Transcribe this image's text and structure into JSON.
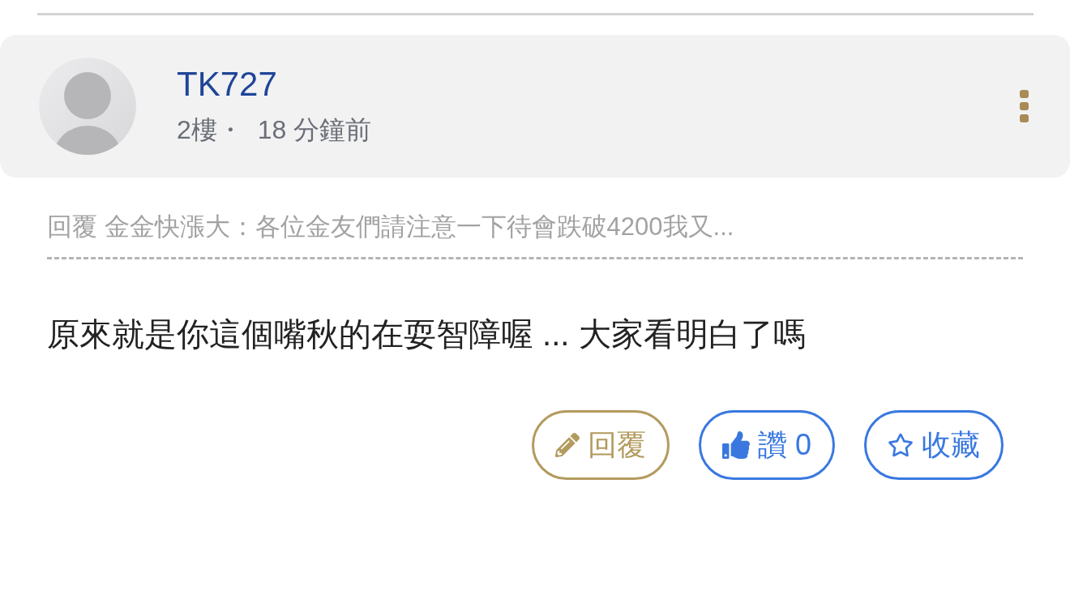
{
  "post": {
    "author": "TK727",
    "floor": "2樓・",
    "time": "18 分鐘前",
    "quote": "回覆 金金快漲大：各位金友們請注意一下待會跌破4200我又...",
    "body": "原來就是你這個嘴秋的在耍智障喔 ... 大家看明白了嗎",
    "actions": [
      {
        "kind": "reply",
        "label": "回覆"
      },
      {
        "kind": "like",
        "label": "讚 0"
      },
      {
        "kind": "favorite",
        "label": "收藏"
      }
    ]
  }
}
